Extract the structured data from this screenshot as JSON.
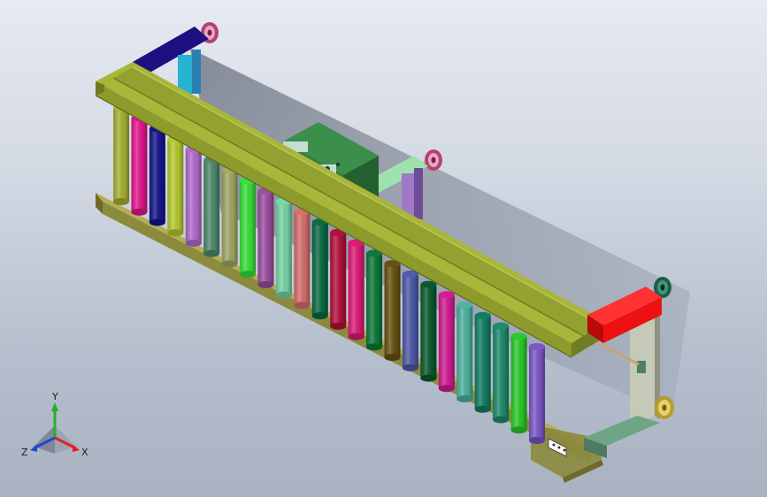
{
  "viewport": {
    "background_top": "#e6eaf1",
    "background_bottom": "#a9b2c1"
  },
  "model": {
    "rail_color": "#8d9a2c",
    "base_color": "#8c8a3d",
    "motor_box_color": "#2e7d3a",
    "red_bracket_color": "#ee1111",
    "blue_bracket_color": "#1d1080",
    "frame_color": "#b9bfae",
    "roller_count": 24,
    "roller_colors": [
      "#a8b330",
      "#e5168f",
      "#16158f",
      "#b6cc2e",
      "#b16ccf",
      "#4e8a6b",
      "#a3a864",
      "#38e03a",
      "#9d4fa0",
      "#78d6a7",
      "#d86f6b",
      "#0b6b45",
      "#b4103b",
      "#e01a78",
      "#0c7a3b",
      "#665211",
      "#4f5aa8",
      "#0a5a2f",
      "#d41c93",
      "#4fb3a0",
      "#127f63",
      "#1e8b6a",
      "#28cc28",
      "#7b58c8"
    ]
  },
  "triad": {
    "labels": {
      "x": "X",
      "y": "Y",
      "z": "Z"
    },
    "x_color": "#e22222",
    "y_color": "#22b322",
    "z_color": "#2244d8"
  }
}
